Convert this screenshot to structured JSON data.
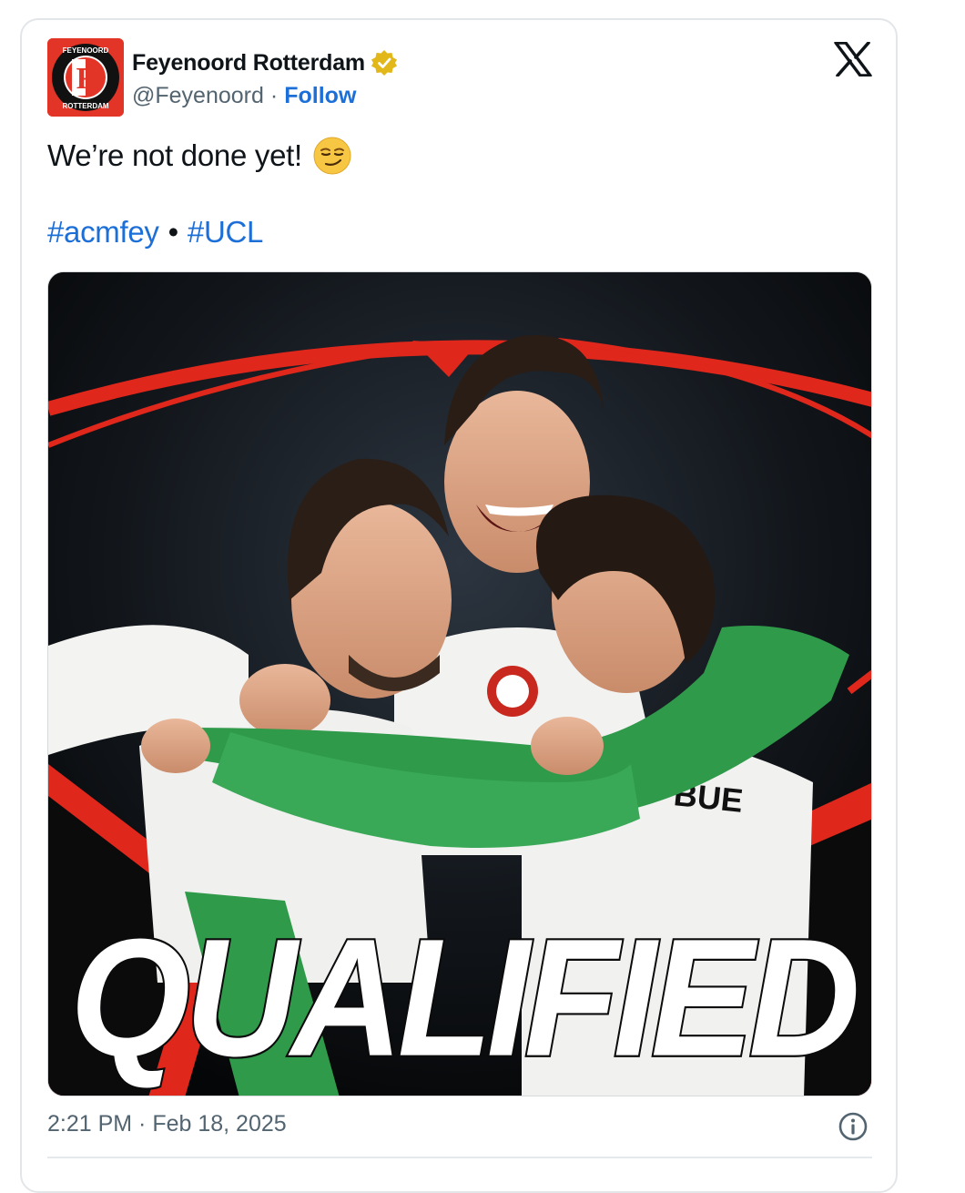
{
  "tweet": {
    "display_name": "Feyenoord Rotterdam",
    "handle": "@Feyenoord",
    "separator": "·",
    "follow_label": "Follow",
    "text": "We’re not done yet!",
    "emoji": "smirking-face-emoji",
    "hashtags": [
      "#acmfey",
      "#UCL"
    ],
    "hashtag_separator": "•",
    "timestamp": "2:21 PM · Feb 18, 2025"
  },
  "avatar": {
    "logo_letter": "F",
    "ring_text_top": "FEYENOORD",
    "ring_text_bottom": "ROTTERDAM"
  },
  "media": {
    "headline": "QUALIFIED",
    "player_name_fragment": "BUE"
  },
  "icons": {
    "verified": "verified-badge-icon",
    "x_logo": "x-logo-icon",
    "info": "info-icon"
  },
  "colors": {
    "link": "#1d6fd8",
    "secondary_text": "#536471",
    "verified_gold": "#e2b719",
    "brand_red": "#e23527",
    "kit_green": "#2f9a4a"
  }
}
